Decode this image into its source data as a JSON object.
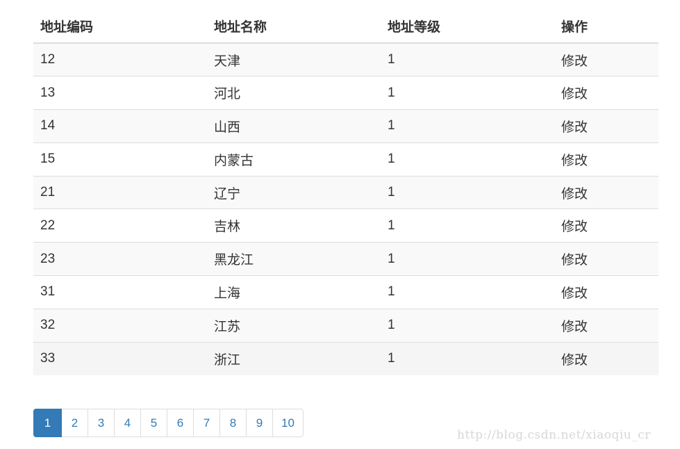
{
  "table": {
    "headers": {
      "code": "地址编码",
      "name": "地址名称",
      "level": "地址等级",
      "action": "操作"
    },
    "rows": [
      {
        "code": "12",
        "name": "天津",
        "level": "1",
        "action": "修改"
      },
      {
        "code": "13",
        "name": "河北",
        "level": "1",
        "action": "修改"
      },
      {
        "code": "14",
        "name": "山西",
        "level": "1",
        "action": "修改"
      },
      {
        "code": "15",
        "name": "内蒙古",
        "level": "1",
        "action": "修改"
      },
      {
        "code": "21",
        "name": "辽宁",
        "level": "1",
        "action": "修改"
      },
      {
        "code": "22",
        "name": "吉林",
        "level": "1",
        "action": "修改"
      },
      {
        "code": "23",
        "name": "黑龙江",
        "level": "1",
        "action": "修改"
      },
      {
        "code": "31",
        "name": "上海",
        "level": "1",
        "action": "修改"
      },
      {
        "code": "32",
        "name": "江苏",
        "level": "1",
        "action": "修改"
      },
      {
        "code": "33",
        "name": "浙江",
        "level": "1",
        "action": "修改"
      }
    ]
  },
  "pagination": {
    "pages": [
      "1",
      "2",
      "3",
      "4",
      "5",
      "6",
      "7",
      "8",
      "9",
      "10"
    ],
    "active": "1",
    "active_color": "#337ab7",
    "link_color": "#337ab7"
  },
  "watermark": "http://blog.csdn.net/xiaoqiu_cr"
}
